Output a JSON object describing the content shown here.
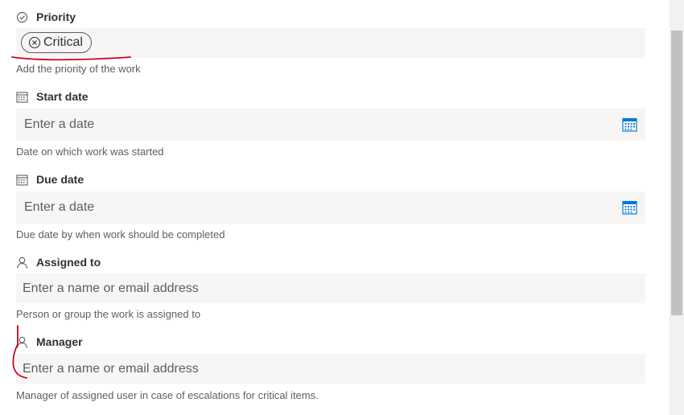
{
  "priority": {
    "label": "Priority",
    "icon": "check-circle-icon",
    "chip_text": "Critical",
    "description": "Add the priority of the work"
  },
  "start_date": {
    "label": "Start date",
    "icon": "calendar-icon",
    "placeholder": "Enter a date",
    "description": "Date on which work was started"
  },
  "due_date": {
    "label": "Due date",
    "icon": "calendar-icon",
    "placeholder": "Enter a date",
    "description": "Due date by when work should be completed"
  },
  "assigned_to": {
    "label": "Assigned to",
    "icon": "person-icon",
    "placeholder": "Enter a name or email address",
    "description": "Person or group the work is assigned to"
  },
  "manager": {
    "label": "Manager",
    "icon": "person-icon",
    "placeholder": "Enter a name or email address",
    "description": "Manager of assigned user in case of escalations for critical items."
  },
  "colors": {
    "field_bg": "#f7f6f5",
    "calendar_accent": "#0078d4",
    "annotation": "#d0021b"
  }
}
